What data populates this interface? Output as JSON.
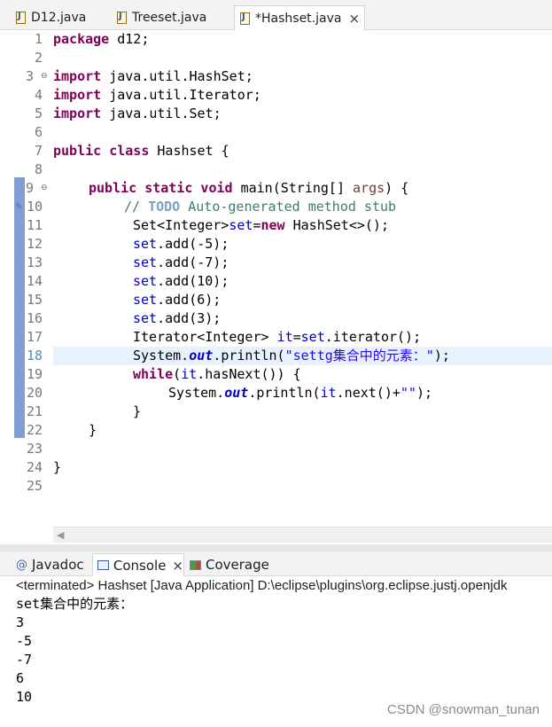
{
  "editor_tabs": [
    {
      "label": "D12.java",
      "active": false
    },
    {
      "label": "Treeset.java",
      "active": false
    },
    {
      "label": "*Hashset.java",
      "active": true,
      "close": "×"
    }
  ],
  "editor": {
    "line_numbers": [
      "1",
      "2",
      "3",
      "4",
      "5",
      "6",
      "7",
      "8",
      "9",
      "10",
      "11",
      "12",
      "13",
      "14",
      "15",
      "16",
      "17",
      "18",
      "19",
      "20",
      "21",
      "22",
      "23",
      "24",
      "25"
    ],
    "current_line": "18",
    "code": {
      "l1": {
        "kw": "package",
        "rest": " d12;"
      },
      "l3": {
        "kw": "import",
        "rest": " java.util.HashSet;"
      },
      "l4": {
        "kw": "import",
        "rest": " java.util.Iterator;"
      },
      "l5": {
        "kw": "import",
        "rest": " java.util.Set;"
      },
      "l7": {
        "kw": "public class",
        "rest": " Hashset {"
      },
      "l9": {
        "kw": "public static void",
        "rest": " main(String[] ",
        "param": "args",
        "tail": ") {"
      },
      "l10": {
        "prefix": "// ",
        "todo": "TODO",
        "rest": " Auto-generated method stub"
      },
      "l11": {
        "a": "Set<Integer>",
        "var": "set",
        "b": "=",
        "kw": "new",
        "c": " HashSet<>();"
      },
      "l12": {
        "var": "set",
        "rest": ".add(-5);"
      },
      "l13": {
        "var": "set",
        "rest": ".add(-7);"
      },
      "l14": {
        "var": "set",
        "rest": ".add(10);"
      },
      "l15": {
        "var": "set",
        "rest": ".add(6);"
      },
      "l16": {
        "var": "set",
        "rest": ".add(3);"
      },
      "l17": {
        "a": "Iterator<Integer> ",
        "var": "it",
        "b": "=",
        "var2": "set",
        "c": ".iterator();"
      },
      "l18": {
        "a": "System.",
        "field": "out",
        "b": ".println(",
        "str": "\"settg集合中的元素：\"",
        "c": ");"
      },
      "l19": {
        "kw": "while",
        "a": "(",
        "var": "it",
        "b": ".hasNext()) {"
      },
      "l20": {
        "a": "System.",
        "field": "out",
        "b": ".println(",
        "var": "it",
        "c": ".next()+",
        "str": "\"\"",
        "d": ");"
      },
      "l21": {
        "rest": "}"
      },
      "l22": {
        "rest": "}"
      },
      "l24": {
        "rest": "}"
      }
    }
  },
  "views": {
    "tabs": [
      {
        "label": "Javadoc",
        "icon": "at-icon"
      },
      {
        "label": "Console",
        "icon": "console-icon",
        "close": "×"
      },
      {
        "label": "Coverage",
        "icon": "coverage-icon"
      }
    ],
    "status": "<terminated> Hashset [Java Application] D:\\eclipse\\plugins\\org.eclipse.justj.openjdk",
    "output": [
      "set集合中的元素：",
      "3",
      "-5",
      "-7",
      "6",
      "10"
    ]
  },
  "watermark": "CSDN @snowman_tunan",
  "colors": {
    "keyword": "#7f0055",
    "field": "#0000c0",
    "string": "#2a00ff",
    "comment": "#3f7f5f",
    "current_line": "#e8f2fe"
  }
}
